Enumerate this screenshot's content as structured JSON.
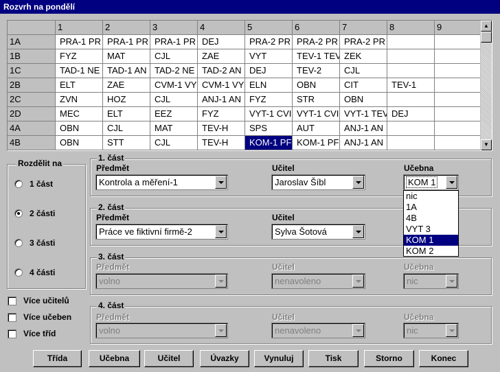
{
  "window": {
    "title": "Rozvrh na pondělí"
  },
  "grid": {
    "columns": [
      "",
      "1",
      "2",
      "3",
      "4",
      "5",
      "6",
      "7",
      "8",
      "9"
    ],
    "rows": [
      {
        "label": "1A",
        "cells": [
          "PRA-1 PR",
          "PRA-1 PR",
          "PRA-1 PR",
          "DEJ",
          "PRA-2 PR",
          "PRA-2 PR",
          "PRA-2 PR",
          "",
          ""
        ]
      },
      {
        "label": "1B",
        "cells": [
          "FYZ",
          "MAT",
          "CJL",
          "ZAE",
          "VYT",
          "TEV-1 TEV",
          "ZEK",
          "",
          ""
        ]
      },
      {
        "label": "1C",
        "cells": [
          "TAD-1 NE",
          "TAD-1 AN",
          "TAD-2 NE",
          "TAD-2 AN",
          "DEJ",
          "TEV-2",
          "CJL",
          "",
          ""
        ]
      },
      {
        "label": "2B",
        "cells": [
          "ELT",
          "ZAE",
          "CVM-1 VY",
          "CVM-1 VY",
          "ELN",
          "OBN",
          "CIT",
          "TEV-1",
          ""
        ]
      },
      {
        "label": "2C",
        "cells": [
          "ZVN",
          "HOZ",
          "CJL",
          "ANJ-1 AN",
          "FYZ",
          "STR",
          "OBN",
          "",
          ""
        ]
      },
      {
        "label": "2D",
        "cells": [
          "MEC",
          "ELT",
          "EEZ",
          "FYZ",
          "VYT-1 CVI",
          "VYT-1 CVI",
          "VYT-1 TEV",
          "DEJ",
          ""
        ]
      },
      {
        "label": "4A",
        "cells": [
          "OBN",
          "CJL",
          "MAT",
          "TEV-H",
          "SPS",
          "AUT",
          "ANJ-1 AN",
          "",
          ""
        ]
      },
      {
        "label": "4B",
        "cells": [
          "OBN",
          "STT",
          "CJL",
          "TEV-H",
          "KOM-1 PF",
          "KOM-1 PF",
          "ANJ-1 AN",
          "",
          ""
        ]
      }
    ]
  },
  "split": {
    "legend": "Rozdělit na",
    "options": [
      "1 část",
      "2 části",
      "3 části",
      "4 části"
    ],
    "selected_index": 1
  },
  "checkboxes": [
    "Více učitelů",
    "Více učeben",
    "Více tříd"
  ],
  "parts": [
    {
      "title": "1. část",
      "subject_label": "Předmět",
      "teacher_label": "Učitel",
      "room_label": "Učebna",
      "subject": "Kontrola a měření-1",
      "teacher": "Jaroslav Šíbl",
      "room": "KOM 1"
    },
    {
      "title": "2. část",
      "subject_label": "Předmět",
      "teacher_label": "Učitel",
      "room_label": "Učebna",
      "subject": "Práce ve fiktivní firmě-2",
      "teacher": "Sylva Šotová",
      "room": ""
    },
    {
      "title": "3. část",
      "subject_label": "Předmět",
      "teacher_label": "Učitel",
      "room_label": "Učebna",
      "subject": "volno",
      "teacher": "nenavoleno",
      "room": "nic"
    },
    {
      "title": "4. část",
      "subject_label": "Předmět",
      "teacher_label": "Učitel",
      "room_label": "Učebna",
      "subject": "volno",
      "teacher": "nenavoleno",
      "room": "nic"
    }
  ],
  "room_dropdown": {
    "items": [
      "nic",
      "1A",
      "4B",
      "VYT 3",
      "KOM 1",
      "KOM 2"
    ],
    "selected_index": 4
  },
  "buttons": [
    "Třída",
    "Učebna",
    "Učitel",
    "Úvazky",
    "Vynuluj",
    "Tisk",
    "Storno",
    "Konec"
  ]
}
